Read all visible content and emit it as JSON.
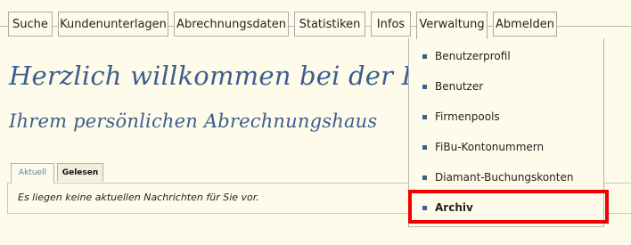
{
  "nav": {
    "items": [
      {
        "label": "Suche"
      },
      {
        "label": "Kundenunterlagen"
      },
      {
        "label": "Abrechnungsdaten"
      },
      {
        "label": "Statistiken"
      },
      {
        "label": "Infos"
      },
      {
        "label": "Verwaltung",
        "active": true
      },
      {
        "label": "Abmelden"
      }
    ]
  },
  "greeting": {
    "line1": "Herzlich willkommen bei der DZH",
    "line2": "Ihrem persönlichen Abrechnungshaus"
  },
  "news": {
    "tabs": [
      {
        "label": "Aktuell",
        "active": true
      },
      {
        "label": "Gelesen",
        "active": false
      }
    ],
    "message": "Es liegen keine aktuellen Nachrichten für Sie vor."
  },
  "dropdown": {
    "items": [
      {
        "label": "Benutzerprofil"
      },
      {
        "label": "Benutzer"
      },
      {
        "label": "Firmenpools"
      },
      {
        "label": "FiBu-Kontonummern"
      },
      {
        "label": "Diamant-Buchungskonten"
      },
      {
        "label": "Archiv",
        "bold": true,
        "highlighted": true
      }
    ]
  },
  "colors": {
    "background": "#fffbea",
    "accent": "#3c5e8e",
    "highlight": "#ee0000"
  }
}
